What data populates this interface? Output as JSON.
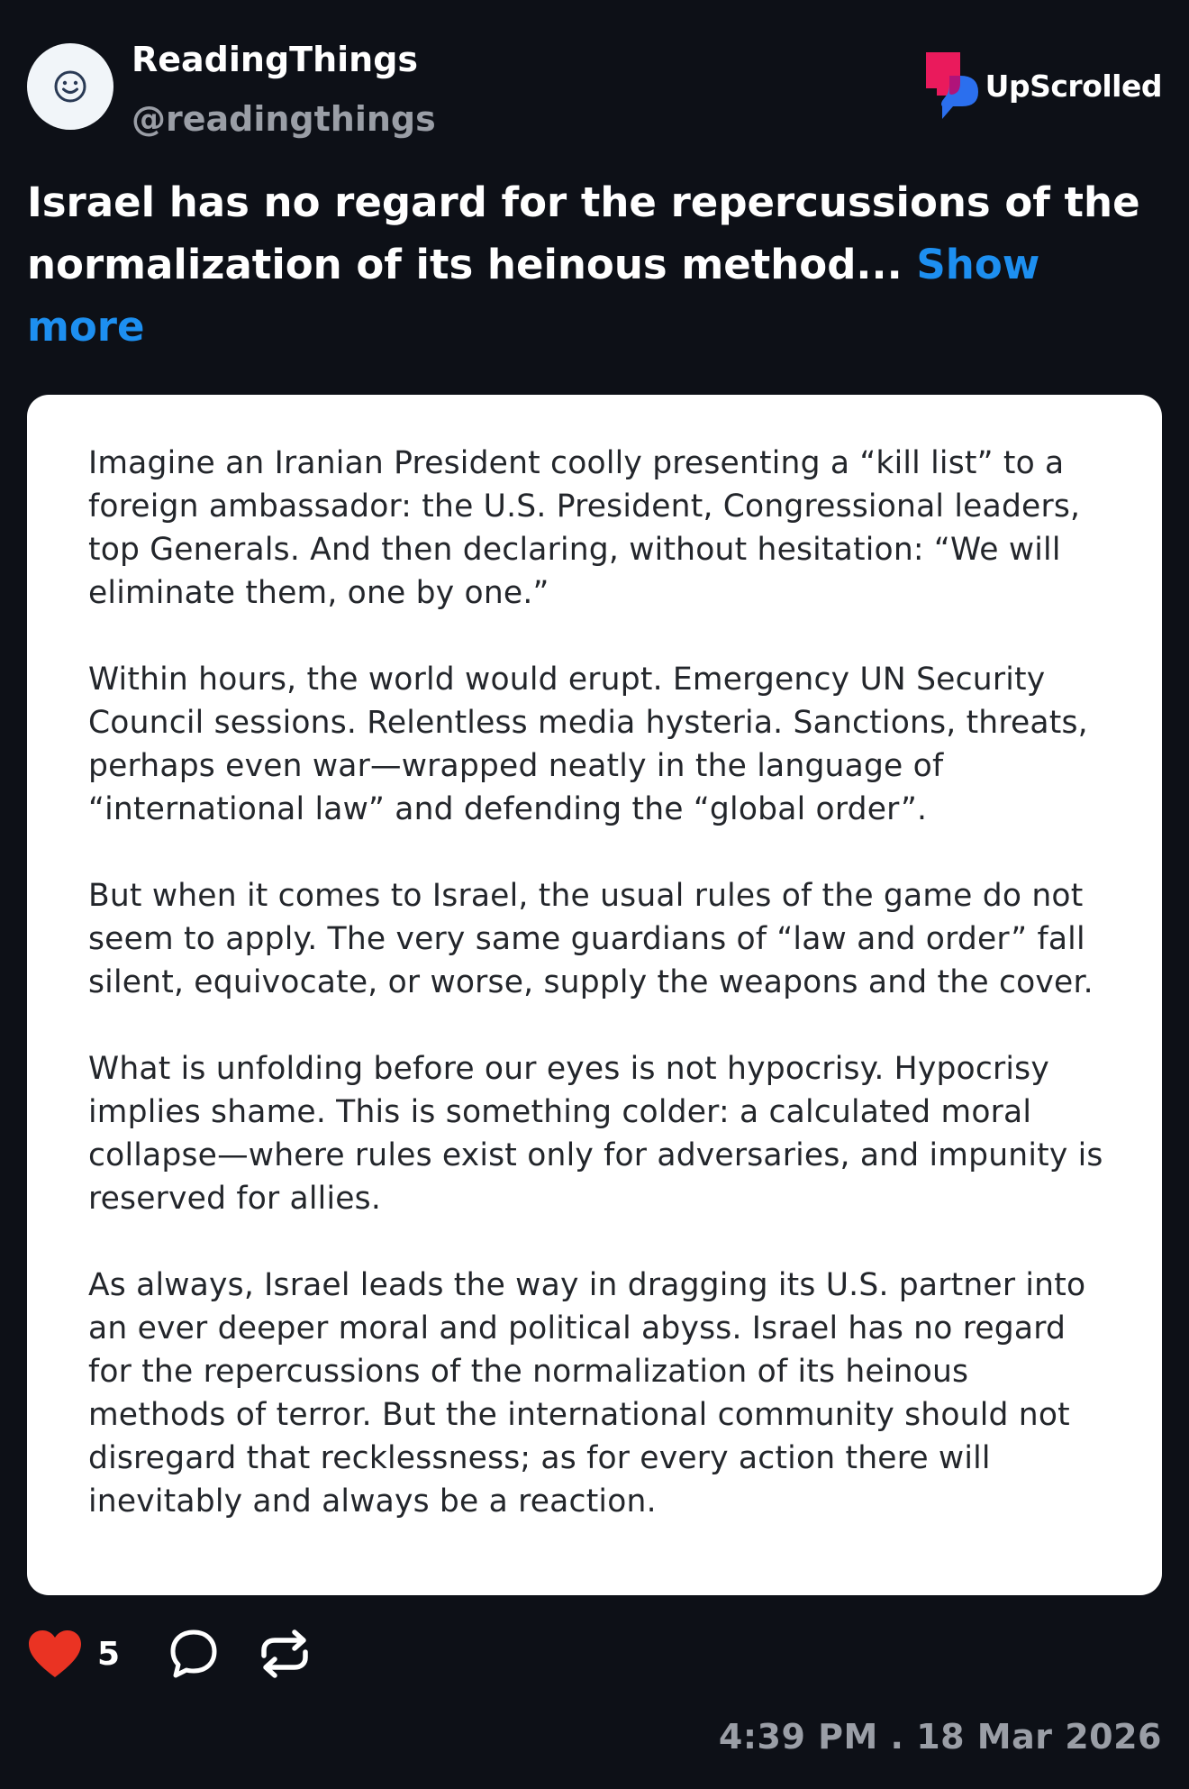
{
  "author": {
    "display_name": "ReadingThings",
    "handle": "@readingthings",
    "avatar_icon": "smiley-icon"
  },
  "brand": {
    "name": "UpScrolled",
    "logo_icon": "upscrolled-logo-icon",
    "colors": {
      "pink": "#ea1a5c",
      "blue": "#2b6fee"
    }
  },
  "post": {
    "headline": "Israel has no regard for the repercussions of the normalization of its heinous method...",
    "show_more_label": "Show more"
  },
  "image_text": {
    "paragraphs": [
      "Imagine an Iranian President coolly presenting a “kill list” to a foreign ambassador: the U.S. President, Congressional leaders, top Generals. And then declaring, without hesitation: “We will eliminate them, one by one.”",
      "Within hours, the world would erupt. Emergency UN Security Council sessions. Relentless media hysteria. Sanctions, threats, perhaps even war—wrapped neatly in the language of “international law” and defending the “global order”.",
      "But when it comes to Israel, the usual rules of the game do not seem to apply. The very same guardians of “law and order” fall silent, equivocate, or worse, supply the weapons and the cover.",
      "What is unfolding before our eyes is not hypocrisy. Hypocrisy implies shame. This is something colder: a calculated moral collapse—where rules exist only for adversaries, and impunity is reserved for allies.",
      "As always, Israel leads the way in dragging its U.S. partner into an ever deeper moral and political abyss. Israel has no regard for the repercussions of the normalization of its heinous methods of terror. But the international community should not disregard that recklessness; as for every action there will inevitably and always be a reaction."
    ]
  },
  "actions": {
    "like_icon": "heart-icon",
    "like_count": "5",
    "like_color": "#ea3323",
    "comment_icon": "comment-icon",
    "repost_icon": "repost-icon"
  },
  "meta": {
    "timestamp": "4:39 PM . 18 Mar 2026"
  },
  "colors": {
    "background": "#0d1017",
    "link": "#1d8ff0",
    "muted": "#9a9ea6"
  }
}
